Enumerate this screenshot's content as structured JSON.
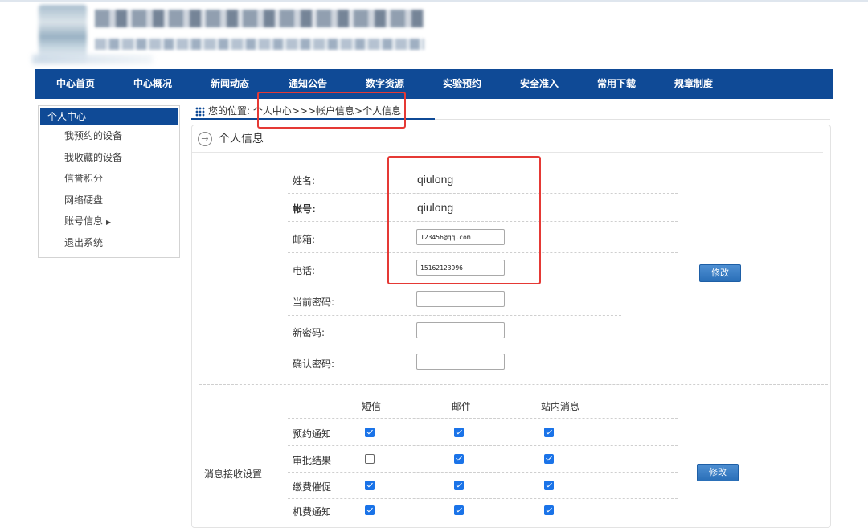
{
  "nav": {
    "items": [
      "中心首页",
      "中心概况",
      "新闻动态",
      "通知公告",
      "数字资源",
      "实验预约",
      "安全准入",
      "常用下载",
      "规章制度"
    ]
  },
  "sidebar": {
    "header": "个人中心",
    "items": [
      {
        "label": "我预约的设备"
      },
      {
        "label": "我收藏的设备"
      },
      {
        "label": "信誉积分"
      },
      {
        "label": "网络硬盘"
      },
      {
        "label": "账号信息"
      },
      {
        "label": "退出系统"
      }
    ]
  },
  "breadcrumb": {
    "prefix": "您的位置:",
    "path": "个人中心>>>帐户信息>个人信息"
  },
  "panel": {
    "title": "个人信息"
  },
  "profile": {
    "name_label": "姓名:",
    "name_value": "qiulong",
    "account_label": "帐号:",
    "account_value": "qiulong",
    "email_label": "邮箱:",
    "email_value": "123456@qq.com",
    "phone_label": "电话:",
    "phone_value": "15162123996",
    "current_pwd_label": "当前密码:",
    "new_pwd_label": "新密码:",
    "confirm_pwd_label": "确认密码:",
    "modify_label": "修改"
  },
  "notifications": {
    "section_label": "消息接收设置",
    "columns": [
      "短信",
      "邮件",
      "站内消息"
    ],
    "rows": [
      {
        "label": "预约通知",
        "checks": [
          true,
          true,
          true
        ]
      },
      {
        "label": "审批结果",
        "checks": [
          false,
          true,
          true
        ]
      },
      {
        "label": "缴费催促",
        "checks": [
          true,
          true,
          true
        ]
      },
      {
        "label": "机费通知",
        "checks": [
          true,
          true,
          true
        ]
      }
    ],
    "modify_label": "修改"
  },
  "colors": {
    "nav_bg": "#0f4a96",
    "checkbox": "#1a73e8",
    "highlight_box": "#e53935",
    "button": "#2a6fb8"
  }
}
